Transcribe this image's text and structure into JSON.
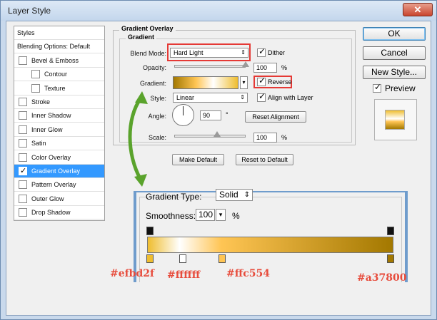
{
  "window": {
    "title": "Layer Style",
    "close_label": "✕"
  },
  "styles_list": {
    "items": [
      {
        "label": "Styles",
        "checkbox": false,
        "checked": false,
        "indent": 0,
        "selected": false
      },
      {
        "label": "Blending Options: Default",
        "checkbox": false,
        "checked": false,
        "indent": 0,
        "selected": false
      },
      {
        "label": "Bevel & Emboss",
        "checkbox": true,
        "checked": false,
        "indent": 0,
        "selected": false
      },
      {
        "label": "Contour",
        "checkbox": true,
        "checked": false,
        "indent": 1,
        "selected": false
      },
      {
        "label": "Texture",
        "checkbox": true,
        "checked": false,
        "indent": 1,
        "selected": false
      },
      {
        "label": "Stroke",
        "checkbox": true,
        "checked": false,
        "indent": 0,
        "selected": false
      },
      {
        "label": "Inner Shadow",
        "checkbox": true,
        "checked": false,
        "indent": 0,
        "selected": false
      },
      {
        "label": "Inner Glow",
        "checkbox": true,
        "checked": false,
        "indent": 0,
        "selected": false
      },
      {
        "label": "Satin",
        "checkbox": true,
        "checked": false,
        "indent": 0,
        "selected": false
      },
      {
        "label": "Color Overlay",
        "checkbox": true,
        "checked": false,
        "indent": 0,
        "selected": false
      },
      {
        "label": "Gradient Overlay",
        "checkbox": true,
        "checked": true,
        "indent": 0,
        "selected": true
      },
      {
        "label": "Pattern Overlay",
        "checkbox": true,
        "checked": false,
        "indent": 0,
        "selected": false
      },
      {
        "label": "Outer Glow",
        "checkbox": true,
        "checked": false,
        "indent": 0,
        "selected": false
      },
      {
        "label": "Drop Shadow",
        "checkbox": true,
        "checked": false,
        "indent": 0,
        "selected": false
      }
    ]
  },
  "gradient_overlay": {
    "section_title": "Gradient Overlay",
    "group_title": "Gradient",
    "blend_mode_label": "Blend Mode:",
    "blend_mode_value": "Hard Light",
    "dither_label": "Dither",
    "dither_checked": true,
    "opacity_label": "Opacity:",
    "opacity_value": "100",
    "opacity_level": 1.0,
    "gradient_label": "Gradient:",
    "reverse_label": "Reverse",
    "reverse_checked": true,
    "style_label": "Style:",
    "style_value": "Linear",
    "align_label": "Align with Layer",
    "align_checked": true,
    "angle_label": "Angle:",
    "angle_value": "90",
    "angle_unit": "°",
    "reset_alignment_label": "Reset Alignment",
    "scale_label": "Scale:",
    "scale_value": "100",
    "scale_level": 0.6,
    "percent": "%",
    "make_default_label": "Make Default",
    "reset_to_default_label": "Reset to Default"
  },
  "side_buttons": {
    "ok_label": "OK",
    "cancel_label": "Cancel",
    "new_style_label": "New Style...",
    "preview_label": "Preview",
    "preview_checked": true
  },
  "gradient_editor": {
    "gradient_type_label": "Gradient Type:",
    "gradient_type_value": "Solid",
    "smoothness_label": "Smoothness:",
    "smoothness_value": "100",
    "percent": "%"
  },
  "annotations": {
    "stop_1": "#efbd2f",
    "stop_2": "#ffffff",
    "stop_3": "#ffc554",
    "stop_4": "#a37800"
  },
  "colors": {
    "stop_1": "#efbd2f",
    "stop_2": "#ffffff",
    "stop_3": "#ffc554",
    "stop_4": "#a37800",
    "highlight": "#e53935",
    "arrow": "#5aa32c",
    "selection": "#3399ff"
  }
}
